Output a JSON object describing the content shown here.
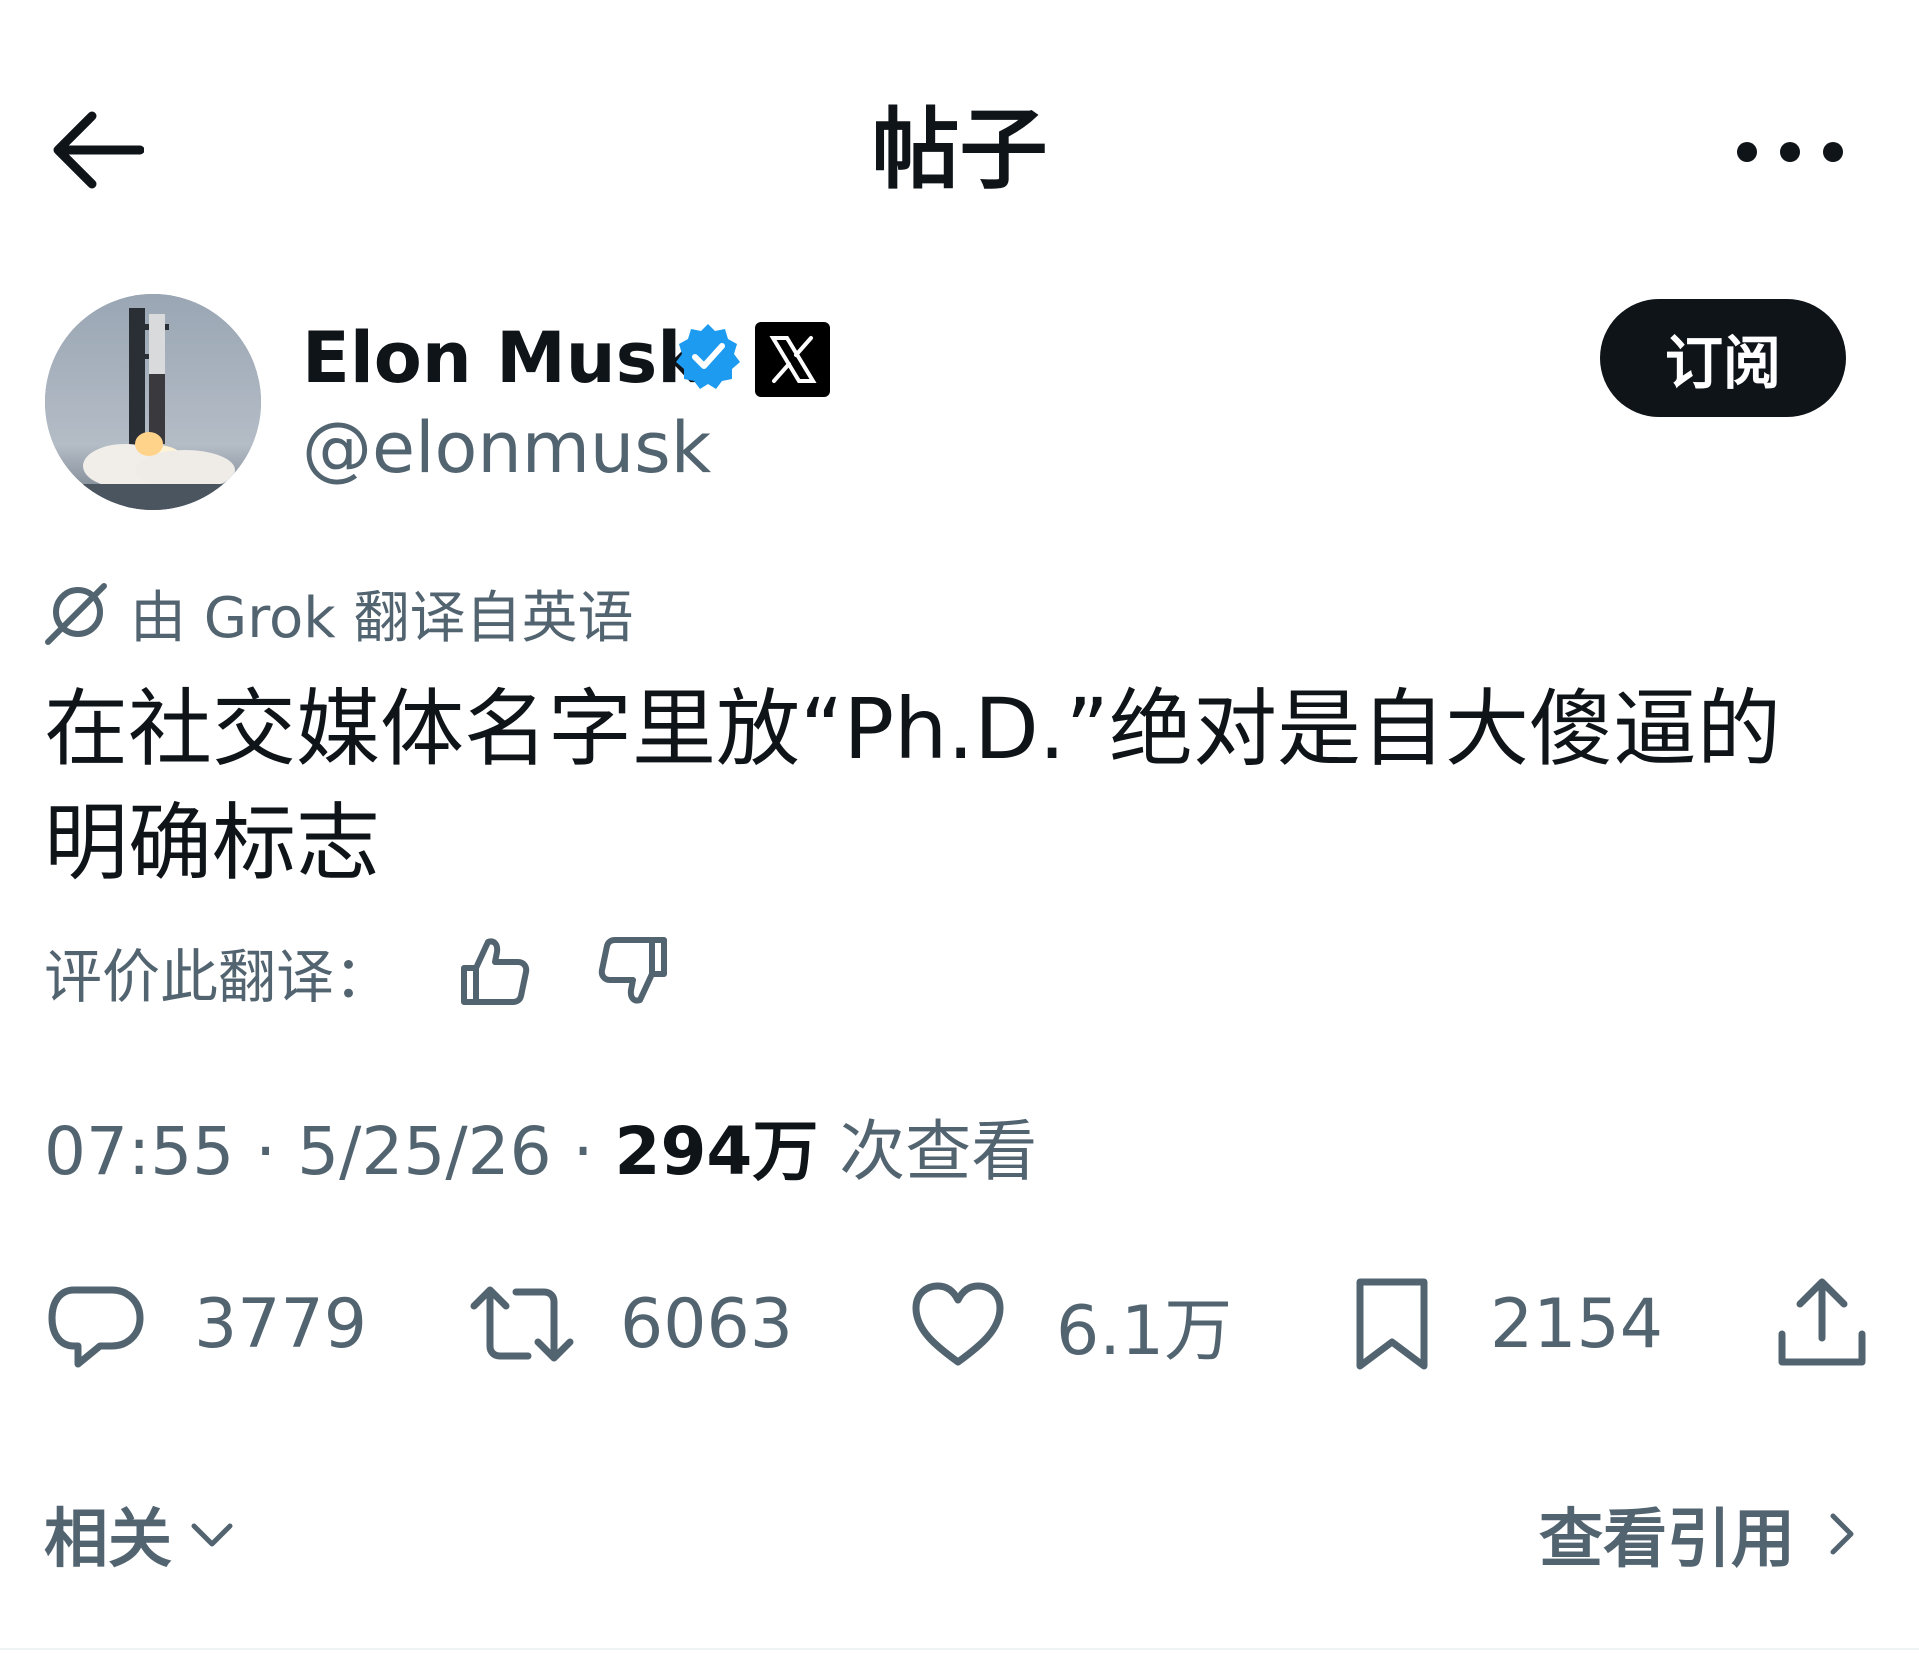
{
  "header": {
    "title": "帖子"
  },
  "author": {
    "display_name": "Elon Musk",
    "handle": "@elonmusk",
    "subscribe_label": "订阅",
    "verified_color": "#1d9bf0"
  },
  "translation": {
    "note": "由 Grok 翻译自英语",
    "rate_label": "评价此翻译："
  },
  "tweet": {
    "text": "在社交媒体名字里放“Ph.D.”绝对是自大傻逼的明确标志"
  },
  "meta": {
    "time": "07:55",
    "separator": " · ",
    "date": "5/25/26",
    "views_count": "294万",
    "views_label": " 次查看"
  },
  "actions": {
    "replies": "3779",
    "reposts": "6063",
    "likes": "6.1万",
    "bookmarks": "2154"
  },
  "footer": {
    "related_label": "相关",
    "quotes_label": "查看引用"
  },
  "icons": {
    "back": "arrow-left-icon",
    "more": "more-horizontal-icon",
    "verified": "verified-badge-icon",
    "affiliate": "x-logo-icon",
    "grok": "grok-icon",
    "thumb_up": "thumbs-up-icon",
    "thumb_down": "thumbs-down-icon",
    "reply": "reply-bubble-icon",
    "repost": "repost-icon",
    "like": "heart-icon",
    "bookmark": "bookmark-icon",
    "share": "share-icon"
  }
}
